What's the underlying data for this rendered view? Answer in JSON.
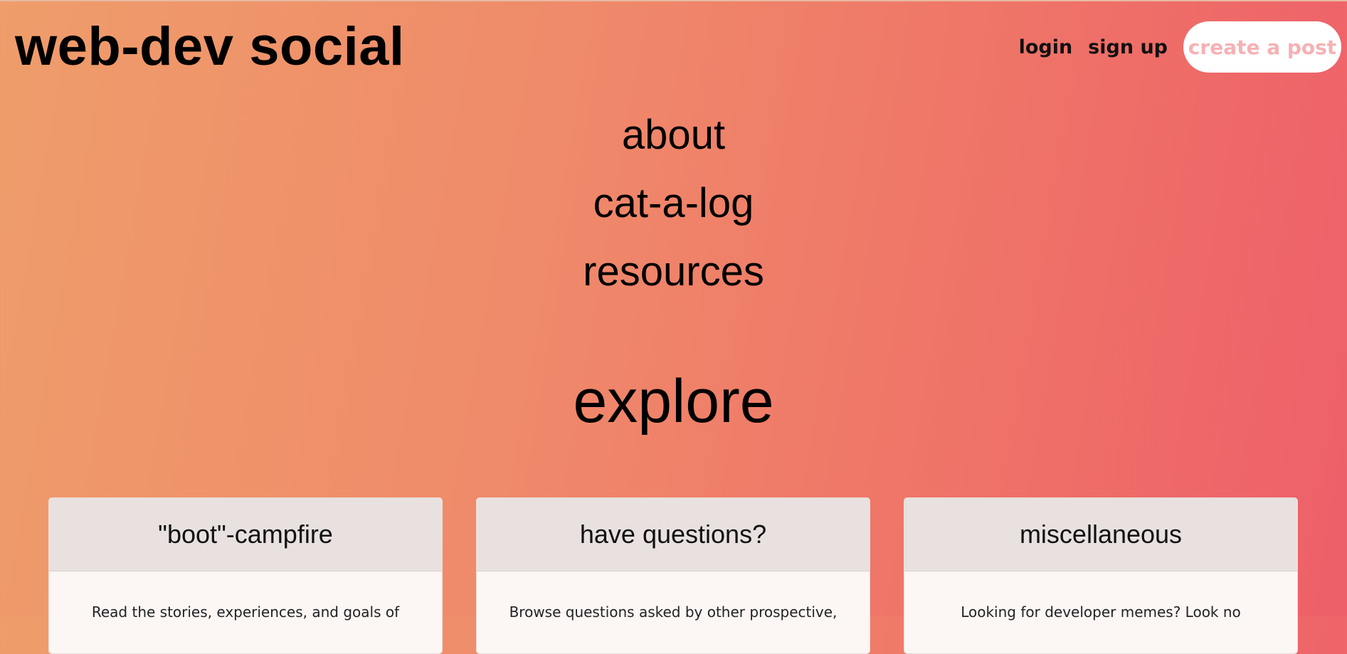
{
  "header": {
    "brand": "web-dev social",
    "login_label": "login",
    "signup_label": "sign up",
    "create_post_label": "create a post"
  },
  "main_nav": {
    "items": [
      {
        "label": "about"
      },
      {
        "label": "cat-a-log"
      },
      {
        "label": "resources"
      }
    ]
  },
  "explore": {
    "title": "explore",
    "cards": [
      {
        "title": "\"boot\"-campfire",
        "text": "Read the stories, experiences, and goals of"
      },
      {
        "title": "have questions?",
        "text": "Browse questions asked by other prospective,"
      },
      {
        "title": "miscellaneous",
        "text": "Looking for developer memes? Look no"
      }
    ]
  },
  "colors": {
    "gradient_start": "#ef9d6b",
    "gradient_end": "#ee5f69",
    "create_button_text": "#f6b1b5",
    "card_header_bg": "#e8e1df",
    "card_body_bg": "#fcf6f5"
  }
}
